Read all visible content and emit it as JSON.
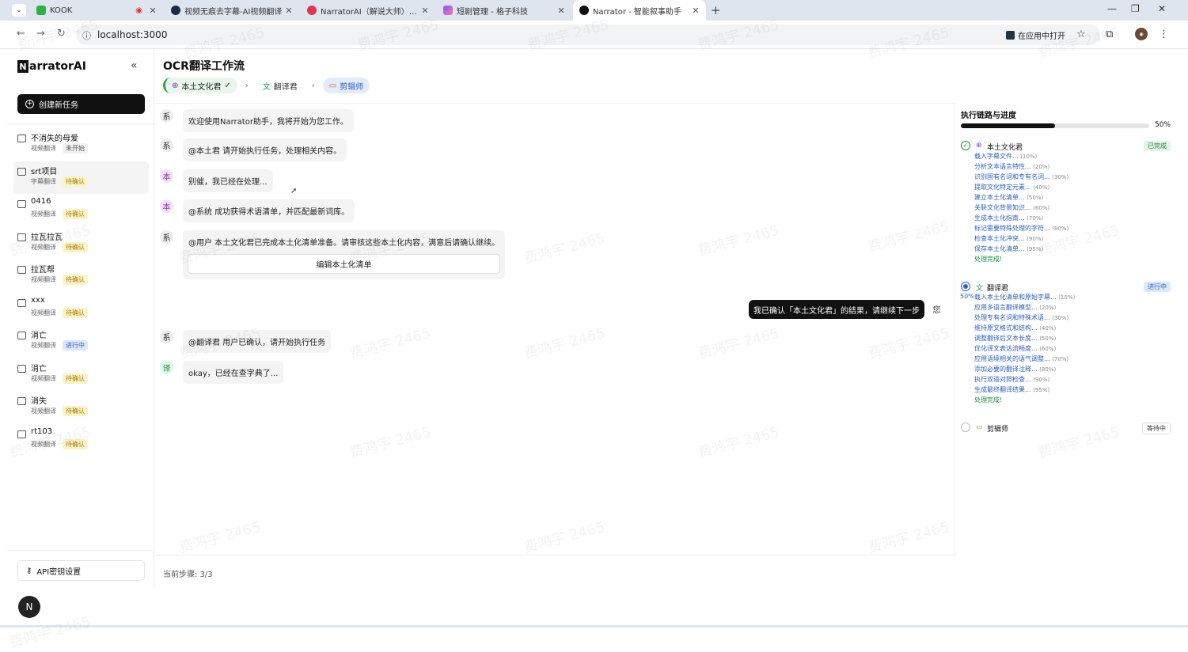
{
  "browser": {
    "tabs": [
      {
        "title": "KOOK",
        "active": false
      },
      {
        "title": "视频无痕去字幕-AI视频翻译",
        "active": false
      },
      {
        "title": "NarratorAI（解说大师）开放平",
        "active": false
      },
      {
        "title": "短剧管理 - 格子科技",
        "active": false
      },
      {
        "title": "Narrator - 智能叙事助手",
        "active": true
      }
    ],
    "url": "localhost:3000",
    "open_in_app": "在应用中打开"
  },
  "sidebar": {
    "logo_letter": "N",
    "logo_rest": "arratorAI",
    "new_task": "创建新任务",
    "tasks": [
      {
        "name": "不消失的母爱",
        "type": "视频翻译",
        "status": "未开始",
        "kind": "none"
      },
      {
        "name": "srt项目",
        "type": "字幕翻译",
        "status": "待确认",
        "kind": "wait"
      },
      {
        "name": "0416",
        "type": "视频翻译",
        "status": "待确认",
        "kind": "wait"
      },
      {
        "name": "拉瓦拉瓦",
        "type": "视频翻译",
        "status": "待确认",
        "kind": "wait"
      },
      {
        "name": "拉瓦帮",
        "type": "视频翻译",
        "status": "待确认",
        "kind": "wait"
      },
      {
        "name": "xxx",
        "type": "视频翻译",
        "status": "待确认",
        "kind": "wait"
      },
      {
        "name": "消亡",
        "type": "视频翻译",
        "status": "进行中",
        "kind": "run"
      },
      {
        "name": "消亡",
        "type": "视频翻译",
        "status": "待确认",
        "kind": "wait"
      },
      {
        "name": "消失",
        "type": "视频翻译",
        "status": "待确认",
        "kind": "wait"
      },
      {
        "name": "rt103",
        "type": "视频翻译",
        "status": "待确认",
        "kind": "wait"
      }
    ],
    "api_key": "API密钥设置"
  },
  "main": {
    "title": "OCR翻译工作流",
    "steps": [
      {
        "label": "本土文化君",
        "state": "done"
      },
      {
        "label": "翻译君",
        "state": "run"
      },
      {
        "label": "剪辑师",
        "state": "cut"
      }
    ],
    "messages": [
      {
        "avatar": "系",
        "role": "sys",
        "text": "欢迎使用Narrator助手，我将开始为您工作。"
      },
      {
        "avatar": "系",
        "role": "sys",
        "text": "@本土君 请开始执行任务，处理相关内容。"
      },
      {
        "avatar": "本",
        "role": "loc",
        "text": "别催，我已经在处理..."
      },
      {
        "avatar": "本",
        "role": "loc",
        "text": "@系统 成功获得术语清单，并匹配最新词库。"
      },
      {
        "avatar": "系",
        "role": "sys",
        "text": "@用户 本土文化君已完成本土化清单准备。请审核这些本土化内容，满意后请确认继续。",
        "button": "编辑本土化清单"
      },
      {
        "avatar": "系",
        "role": "sys",
        "text": "@翻译君 用户已确认，请开始执行任务"
      },
      {
        "avatar": "译",
        "role": "tr",
        "text": "okay，已经在查字典了..."
      }
    ],
    "user_message": "我已确认「本土文化君」的结果，请继续下一步",
    "user_avatar": "您",
    "current_step": "当前步骤: 3/3"
  },
  "panel": {
    "title": "执行链路与进度",
    "progress_label": "50%",
    "progress": 0.5,
    "agents": [
      {
        "name": "本土文化君",
        "badge": "已完成",
        "badge_kind": "done",
        "subs": [
          {
            "t": "载入字幕文件...",
            "p": "(10%)"
          },
          {
            "t": "分析文本语言特性...",
            "p": "(20%)"
          },
          {
            "t": "识别固有名词和专有名词...",
            "p": "(30%)"
          },
          {
            "t": "提取文化特定元素...",
            "p": "(40%)"
          },
          {
            "t": "建立本土化清单...",
            "p": "(50%)"
          },
          {
            "t": "关联文化背景知识...",
            "p": "(60%)"
          },
          {
            "t": "生成本土化指南...",
            "p": "(70%)"
          },
          {
            "t": "标记需要特殊处理的字符...",
            "p": "(80%)"
          },
          {
            "t": "检查本土化冲突...",
            "p": "(90%)"
          },
          {
            "t": "保存本土化清单...",
            "p": "(95%)"
          }
        ],
        "final": "处理完成!"
      },
      {
        "name": "翻译君",
        "badge": "进行中",
        "badge_kind": "run",
        "lead": "50%",
        "subs": [
          {
            "t": "载入本土化清单和原始字幕...",
            "p": "(10%)"
          },
          {
            "t": "应用多语言翻译模型...",
            "p": "(20%)"
          },
          {
            "t": "处理专有名词和特殊术语...",
            "p": "(30%)"
          },
          {
            "t": "维持原文格式和结构...",
            "p": "(40%)"
          },
          {
            "t": "调整翻译后文本长度...",
            "p": "(50%)"
          },
          {
            "t": "优化译文表达流畅度...",
            "p": "(60%)"
          },
          {
            "t": "应用语境相关的语气调整...",
            "p": "(70%)"
          },
          {
            "t": "添加必要的翻译注释...",
            "p": "(80%)"
          },
          {
            "t": "执行双语对照检查...",
            "p": "(90%)"
          },
          {
            "t": "生成最终翻译结果...",
            "p": "(95%)"
          }
        ],
        "final": "处理完成!"
      },
      {
        "name": "剪辑师",
        "badge": "等待中",
        "badge_kind": "wait",
        "subs": []
      }
    ]
  },
  "watermark": "费鸿宇 2465",
  "floating_button": "N",
  "colors": {
    "accent": "#111111",
    "done": "#1d8a44",
    "run": "#2d64c8",
    "wait": "#a67c00"
  }
}
